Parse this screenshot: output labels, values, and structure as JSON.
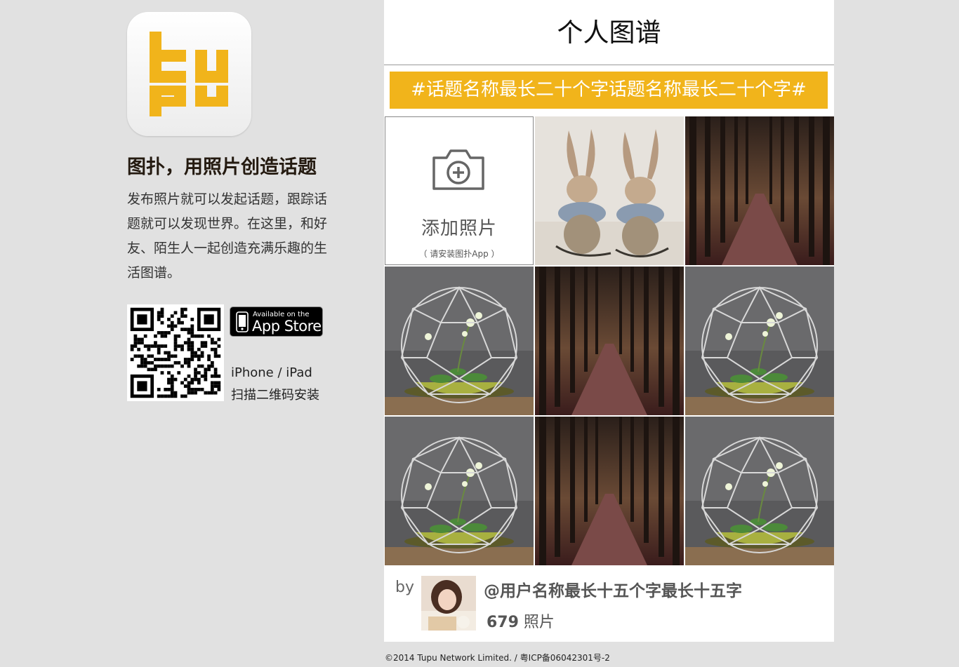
{
  "brand": {
    "logo_text": "tupu",
    "accent_color": "#f1b41b",
    "tagline": "图扑，用照片创造话题",
    "description": "发布照片就可以发起话题，跟踪话题就可以发现世界。在这里，和好友、陌生人一起创造充满乐趣的生活图谱。"
  },
  "download": {
    "qr_icon": "qr-code",
    "appstore_small": "Available on the",
    "appstore_main": "App Store",
    "devices": "iPhone / iPad",
    "scan_hint": "扫描二维码安装"
  },
  "panel": {
    "title": "个人图谱",
    "topic": "#话题名称最长二十个字话题名称最长二十个字#",
    "add_photo": {
      "icon": "camera-plus-icon",
      "label": "添加照片",
      "sub": "（ 请安装图扑App ）"
    },
    "photos": [
      "rabbit-figurines",
      "forest-path",
      "glass-terrarium",
      "forest-path",
      "glass-terrarium",
      "glass-terrarium",
      "forest-path",
      "glass-terrarium"
    ],
    "author": {
      "by": "by",
      "username": "@用户名称最长十五个字最长十五字",
      "photo_count": "679",
      "photo_unit": " 照片"
    }
  },
  "footer": {
    "copyright": "©2014 Tupu Network Limited. / 粤ICP备06042301号-2"
  }
}
